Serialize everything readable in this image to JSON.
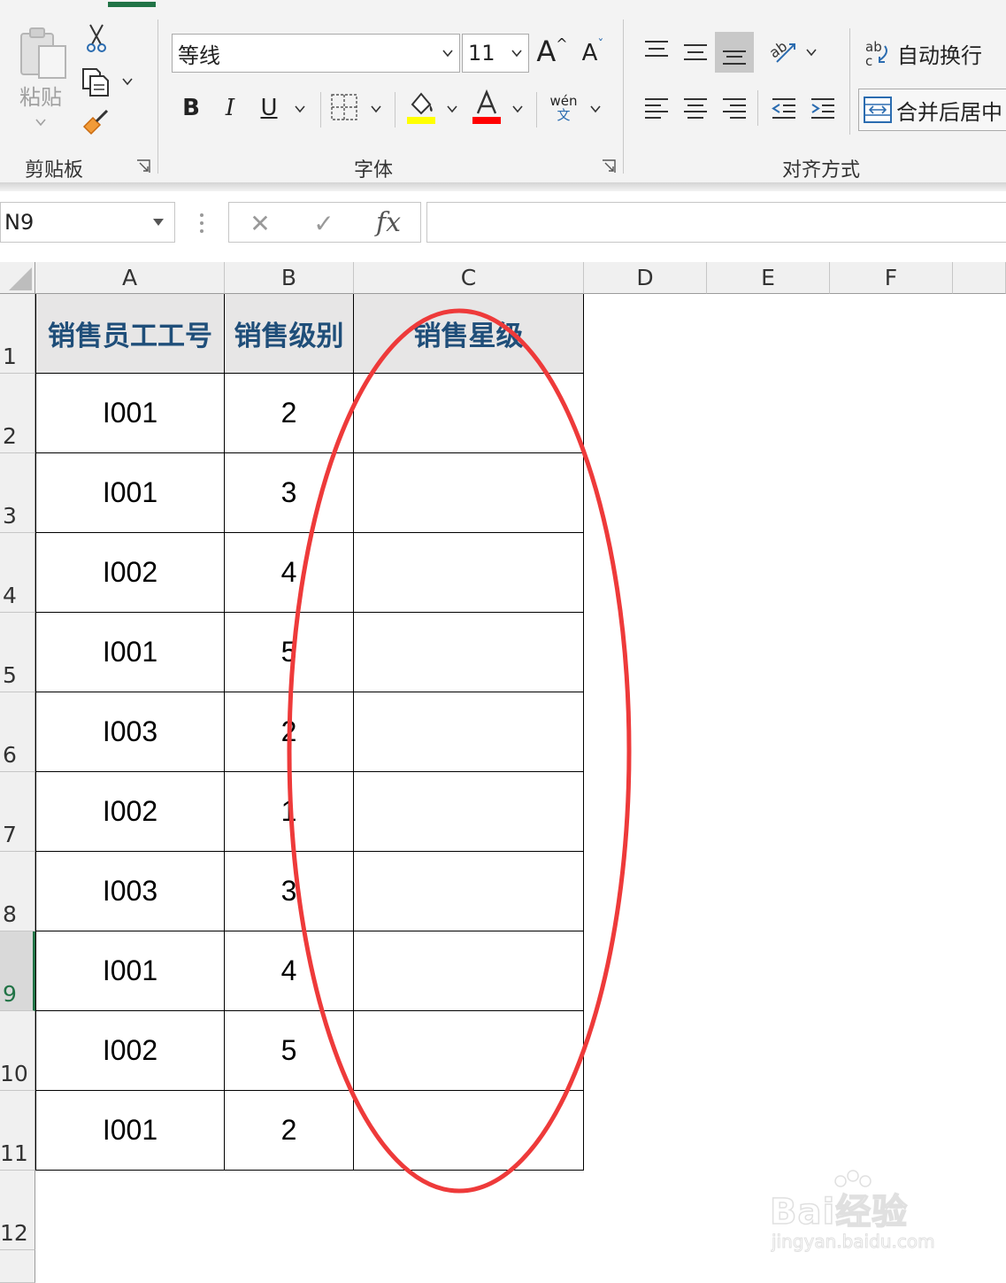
{
  "ribbon": {
    "clipboard": {
      "paste_label": "粘贴",
      "group_label": "剪贴板"
    },
    "font": {
      "group_label": "字体",
      "font_name": "等线",
      "font_size": "11",
      "increase_font": "A",
      "decrease_font": "A",
      "bold": "B",
      "italic": "I",
      "underline": "U",
      "fill_color": "#ffff00",
      "font_color": "#ff0000",
      "phonetic_top": "wén",
      "phonetic_bottom": "文"
    },
    "alignment": {
      "group_label": "对齐方式",
      "wrap_text": "自动换行",
      "merge_center": "合并后居中"
    }
  },
  "formula_bar": {
    "name_box": "N9",
    "cancel": "✕",
    "enter": "✓",
    "fx": "fx",
    "formula": ""
  },
  "columns": [
    "A",
    "B",
    "C",
    "D",
    "E",
    "F"
  ],
  "rows": [
    "1",
    "2",
    "3",
    "4",
    "5",
    "6",
    "7",
    "8",
    "9",
    "10",
    "11",
    "12"
  ],
  "active_row": "9",
  "table": {
    "headers": [
      "销售员工工号",
      "销售级别",
      "销售星级"
    ],
    "data": [
      [
        "I001",
        "2",
        ""
      ],
      [
        "I001",
        "3",
        ""
      ],
      [
        "I002",
        "4",
        ""
      ],
      [
        "I001",
        "5",
        ""
      ],
      [
        "I003",
        "2",
        ""
      ],
      [
        "I002",
        "1",
        ""
      ],
      [
        "I003",
        "3",
        ""
      ],
      [
        "I001",
        "4",
        ""
      ],
      [
        "I002",
        "5",
        ""
      ],
      [
        "I001",
        "2",
        ""
      ]
    ]
  },
  "annotation_color": "#ee3a3a",
  "watermark": {
    "main": "Bai经验",
    "sub": "jingyan.baidu.com"
  }
}
